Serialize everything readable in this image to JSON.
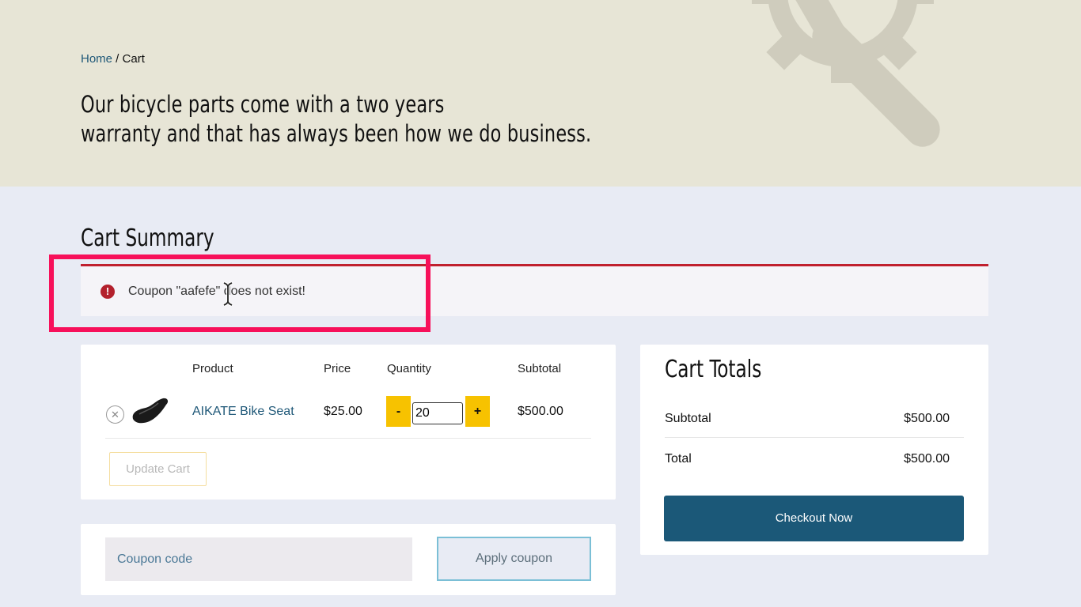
{
  "breadcrumb": {
    "home": "Home",
    "separator": " / ",
    "current": "Cart"
  },
  "hero": {
    "line1": "Our bicycle parts come with a two years",
    "line2": "warranty and that has always been how we do business."
  },
  "cart": {
    "heading": "Cart Summary",
    "notice": {
      "icon": "error-icon",
      "text": "Coupon \"aafefe\" does not exist!"
    },
    "columns": {
      "product": "Product",
      "price": "Price",
      "quantity": "Quantity",
      "subtotal": "Subtotal"
    },
    "items": [
      {
        "name": "AIKATE Bike Seat",
        "price": "$25.00",
        "quantity": "20",
        "subtotal": "$500.00"
      }
    ],
    "decrement_label": "-",
    "increment_label": "+",
    "update_label": "Update Cart",
    "coupon_placeholder": "Coupon code",
    "apply_label": "Apply coupon"
  },
  "totals": {
    "title": "Cart Totals",
    "subtotal_label": "Subtotal",
    "subtotal_value": "$500.00",
    "total_label": "Total",
    "total_value": "$500.00",
    "checkout_label": "Checkout Now"
  },
  "colors": {
    "accent": "#1b5878",
    "qty_button": "#f7c200",
    "error": "#c0202e",
    "annotation": "#f7105a"
  }
}
